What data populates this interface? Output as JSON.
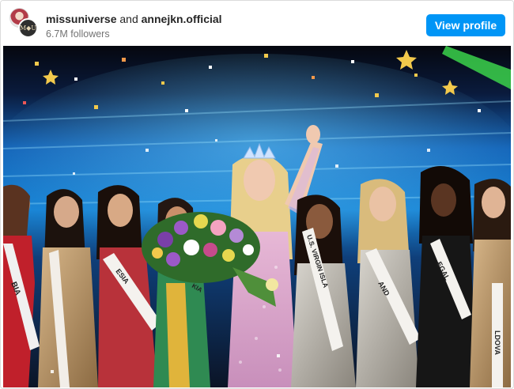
{
  "header": {
    "username_1": "missuniverse",
    "conjunction": "and",
    "username_2": "annejkn.official",
    "followers": "6.7M followers",
    "view_profile_label": "View profile",
    "avatar_2_monogram": "M◆U"
  },
  "post": {
    "image": {
      "semantic": "pageant-crowning-stage-photo",
      "sash_texts": [
        "BIA",
        "ESIA",
        "U.S. VIRGIN ISLA",
        "KIA",
        "AND",
        "EGAL",
        "LDOVA"
      ]
    }
  },
  "colors": {
    "button_bg": "#0095f6",
    "username_text": "#262626",
    "secondary_text": "#737373"
  }
}
